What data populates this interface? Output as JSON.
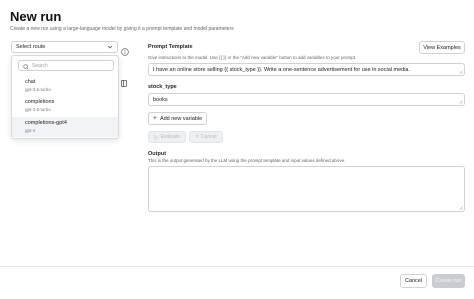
{
  "header": {
    "title": "New run",
    "subtitle": "Create a new run using a large-language model by giving it a prompt template and model parameters"
  },
  "route_select": {
    "value": "Select route",
    "icon": "chevron-down-icon",
    "info_icon": "info-icon"
  },
  "dropdown": {
    "search_placeholder": "Search",
    "options": [
      {
        "name": "chat",
        "model": "gpt-3.5-turbo",
        "selected": false
      },
      {
        "name": "completions",
        "model": "gpt-3.5-turbo",
        "selected": false
      },
      {
        "name": "completions-gpt4",
        "model": "gpt-4",
        "selected": true
      }
    ]
  },
  "prompt_template": {
    "label": "Prompt Template",
    "view_examples_label": "View Examples",
    "helper": "Give instructions to the model. Use {{ }} or the \"Add new variable\" button to add variables to your prompt.",
    "value": "I have an online store selling {{ stock_type }}. Write a one-sentence advertisement for use in social media."
  },
  "variables": [
    {
      "label": "stock_type",
      "value": "books"
    }
  ],
  "add_variable_label": "Add new variable",
  "actions": {
    "evaluate_label": "Evaluate",
    "cancel_label": "Cancel"
  },
  "output": {
    "label": "Output",
    "helper": "This is the output generated by the LLM using the prompt template and input values defined above.",
    "value": ""
  },
  "footer": {
    "cancel_label": "Cancel",
    "create_label": "Create run"
  },
  "colors": {
    "border": "#cfd3d8",
    "disabled_bg": "#c9ccd1",
    "selected_bg": "#f1f3f6"
  }
}
